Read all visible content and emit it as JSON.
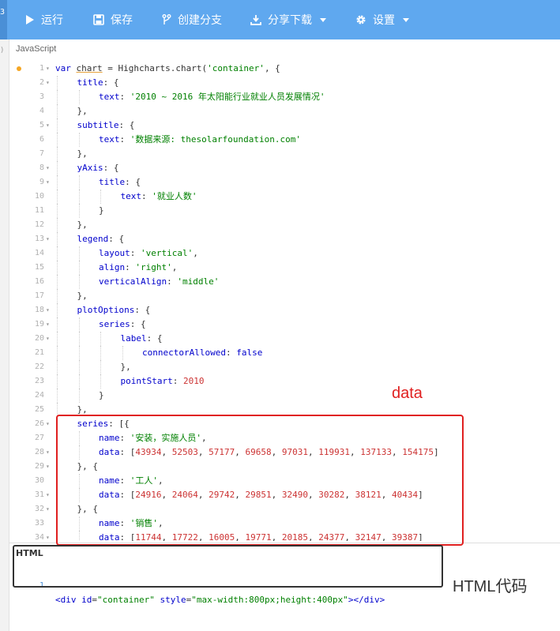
{
  "toolbar": {
    "left_number": "3",
    "run_label": "运行",
    "save_label": "保存",
    "branch_label": "创建分支",
    "share_label": "分享下载",
    "settings_label": "设置"
  },
  "js_panel": {
    "title": "JavaScript",
    "lines": [
      {
        "num": "1",
        "fold": true,
        "bp": true,
        "indent": 0,
        "tokens": [
          [
            "kw",
            "var "
          ],
          [
            "var",
            "chart"
          ],
          [
            "plain",
            " = Highcharts.chart("
          ],
          [
            "str",
            "'container'"
          ],
          [
            "plain",
            ", {"
          ]
        ]
      },
      {
        "num": "2",
        "fold": true,
        "indent": 1,
        "tokens": [
          [
            "key",
            "title"
          ],
          [
            "plain",
            ": {"
          ]
        ]
      },
      {
        "num": "3",
        "indent": 2,
        "tokens": [
          [
            "key",
            "text"
          ],
          [
            "plain",
            ": "
          ],
          [
            "str",
            "'2010 ~ 2016 年太阳能行业就业人员发展情况'"
          ]
        ]
      },
      {
        "num": "4",
        "indent": 1,
        "tokens": [
          [
            "plain",
            "},"
          ]
        ]
      },
      {
        "num": "5",
        "fold": true,
        "indent": 1,
        "tokens": [
          [
            "key",
            "subtitle"
          ],
          [
            "plain",
            ": {"
          ]
        ]
      },
      {
        "num": "6",
        "indent": 2,
        "tokens": [
          [
            "key",
            "text"
          ],
          [
            "plain",
            ": "
          ],
          [
            "str",
            "'数据来源: thesolarfoundation.com'"
          ]
        ]
      },
      {
        "num": "7",
        "indent": 1,
        "tokens": [
          [
            "plain",
            "},"
          ]
        ]
      },
      {
        "num": "8",
        "fold": true,
        "indent": 1,
        "tokens": [
          [
            "key",
            "yAxis"
          ],
          [
            "plain",
            ": {"
          ]
        ]
      },
      {
        "num": "9",
        "fold": true,
        "indent": 2,
        "tokens": [
          [
            "key",
            "title"
          ],
          [
            "plain",
            ": {"
          ]
        ]
      },
      {
        "num": "10",
        "indent": 3,
        "tokens": [
          [
            "key",
            "text"
          ],
          [
            "plain",
            ": "
          ],
          [
            "str",
            "'就业人数'"
          ]
        ]
      },
      {
        "num": "11",
        "indent": 2,
        "tokens": [
          [
            "plain",
            "}"
          ]
        ]
      },
      {
        "num": "12",
        "indent": 1,
        "tokens": [
          [
            "plain",
            "},"
          ]
        ]
      },
      {
        "num": "13",
        "fold": true,
        "indent": 1,
        "tokens": [
          [
            "key",
            "legend"
          ],
          [
            "plain",
            ": {"
          ]
        ]
      },
      {
        "num": "14",
        "indent": 2,
        "tokens": [
          [
            "key",
            "layout"
          ],
          [
            "plain",
            ": "
          ],
          [
            "str",
            "'vertical'"
          ],
          [
            "plain",
            ","
          ]
        ]
      },
      {
        "num": "15",
        "indent": 2,
        "tokens": [
          [
            "key",
            "align"
          ],
          [
            "plain",
            ": "
          ],
          [
            "str",
            "'right'"
          ],
          [
            "plain",
            ","
          ]
        ]
      },
      {
        "num": "16",
        "indent": 2,
        "tokens": [
          [
            "key",
            "verticalAlign"
          ],
          [
            "plain",
            ": "
          ],
          [
            "str",
            "'middle'"
          ]
        ]
      },
      {
        "num": "17",
        "indent": 1,
        "tokens": [
          [
            "plain",
            "},"
          ]
        ]
      },
      {
        "num": "18",
        "fold": true,
        "indent": 1,
        "tokens": [
          [
            "key",
            "plotOptions"
          ],
          [
            "plain",
            ": {"
          ]
        ]
      },
      {
        "num": "19",
        "fold": true,
        "indent": 2,
        "tokens": [
          [
            "key",
            "series"
          ],
          [
            "plain",
            ": {"
          ]
        ]
      },
      {
        "num": "20",
        "fold": true,
        "indent": 3,
        "tokens": [
          [
            "key",
            "label"
          ],
          [
            "plain",
            ": {"
          ]
        ]
      },
      {
        "num": "21",
        "indent": 4,
        "tokens": [
          [
            "key",
            "connectorAllowed"
          ],
          [
            "plain",
            ": "
          ],
          [
            "bool",
            "false"
          ]
        ]
      },
      {
        "num": "22",
        "indent": 3,
        "tokens": [
          [
            "plain",
            "},"
          ]
        ]
      },
      {
        "num": "23",
        "indent": 3,
        "tokens": [
          [
            "key",
            "pointStart"
          ],
          [
            "plain",
            ": "
          ],
          [
            "num",
            "2010"
          ]
        ]
      },
      {
        "num": "24",
        "indent": 2,
        "tokens": [
          [
            "plain",
            "}"
          ]
        ]
      },
      {
        "num": "25",
        "indent": 1,
        "tokens": [
          [
            "plain",
            "},"
          ]
        ]
      },
      {
        "num": "26",
        "fold": true,
        "indent": 1,
        "tokens": [
          [
            "key",
            "series"
          ],
          [
            "plain",
            ": [{"
          ]
        ]
      },
      {
        "num": "27",
        "indent": 2,
        "tokens": [
          [
            "key",
            "name"
          ],
          [
            "plain",
            ": "
          ],
          [
            "str",
            "'安装，实施人员'"
          ],
          [
            "plain",
            ","
          ]
        ]
      },
      {
        "num": "28",
        "fold": true,
        "indent": 2,
        "tokens": [
          [
            "key",
            "data"
          ],
          [
            "plain",
            ": ["
          ],
          [
            "num",
            "43934"
          ],
          [
            "plain",
            ", "
          ],
          [
            "num",
            "52503"
          ],
          [
            "plain",
            ", "
          ],
          [
            "num",
            "57177"
          ],
          [
            "plain",
            ", "
          ],
          [
            "num",
            "69658"
          ],
          [
            "plain",
            ", "
          ],
          [
            "num",
            "97031"
          ],
          [
            "plain",
            ", "
          ],
          [
            "num",
            "119931"
          ],
          [
            "plain",
            ", "
          ],
          [
            "num",
            "137133"
          ],
          [
            "plain",
            ", "
          ],
          [
            "num",
            "154175"
          ],
          [
            "plain",
            "]"
          ]
        ]
      },
      {
        "num": "29",
        "fold": true,
        "indent": 1,
        "tokens": [
          [
            "plain",
            "}, {"
          ]
        ]
      },
      {
        "num": "30",
        "indent": 2,
        "tokens": [
          [
            "key",
            "name"
          ],
          [
            "plain",
            ": "
          ],
          [
            "str",
            "'工人'"
          ],
          [
            "plain",
            ","
          ]
        ]
      },
      {
        "num": "31",
        "fold": true,
        "indent": 2,
        "tokens": [
          [
            "key",
            "data"
          ],
          [
            "plain",
            ": ["
          ],
          [
            "num",
            "24916"
          ],
          [
            "plain",
            ", "
          ],
          [
            "num",
            "24064"
          ],
          [
            "plain",
            ", "
          ],
          [
            "num",
            "29742"
          ],
          [
            "plain",
            ", "
          ],
          [
            "num",
            "29851"
          ],
          [
            "plain",
            ", "
          ],
          [
            "num",
            "32490"
          ],
          [
            "plain",
            ", "
          ],
          [
            "num",
            "30282"
          ],
          [
            "plain",
            ", "
          ],
          [
            "num",
            "38121"
          ],
          [
            "plain",
            ", "
          ],
          [
            "num",
            "40434"
          ],
          [
            "plain",
            "]"
          ]
        ]
      },
      {
        "num": "32",
        "fold": true,
        "indent": 1,
        "tokens": [
          [
            "plain",
            "}, {"
          ]
        ]
      },
      {
        "num": "33",
        "indent": 2,
        "tokens": [
          [
            "key",
            "name"
          ],
          [
            "plain",
            ": "
          ],
          [
            "str",
            "'销售'"
          ],
          [
            "plain",
            ","
          ]
        ]
      },
      {
        "num": "34",
        "fold": true,
        "indent": 2,
        "tokens": [
          [
            "key",
            "data"
          ],
          [
            "plain",
            ": ["
          ],
          [
            "num",
            "11744"
          ],
          [
            "plain",
            ", "
          ],
          [
            "num",
            "17722"
          ],
          [
            "plain",
            ", "
          ],
          [
            "num",
            "16005"
          ],
          [
            "plain",
            ", "
          ],
          [
            "num",
            "19771"
          ],
          [
            "plain",
            ", "
          ],
          [
            "num",
            "20185"
          ],
          [
            "plain",
            ", "
          ],
          [
            "num",
            "24377"
          ],
          [
            "plain",
            ", "
          ],
          [
            "num",
            "32147"
          ],
          [
            "plain",
            ", "
          ],
          [
            "num",
            "39387"
          ],
          [
            "plain",
            "]"
          ]
        ]
      }
    ]
  },
  "html_panel": {
    "title": "HTML",
    "line_num": "1",
    "tokens": [
      [
        "tag",
        "<div "
      ],
      [
        "attr",
        "id"
      ],
      [
        "plain",
        "="
      ],
      [
        "val",
        "\"container\""
      ],
      [
        "plain",
        " "
      ],
      [
        "attr",
        "style"
      ],
      [
        "plain",
        "="
      ],
      [
        "val",
        "\"max-width:800px;height:400px\""
      ],
      [
        "tag",
        "></div>"
      ]
    ]
  },
  "annotations": {
    "data_label": "data",
    "html_label": "HTML代码"
  }
}
